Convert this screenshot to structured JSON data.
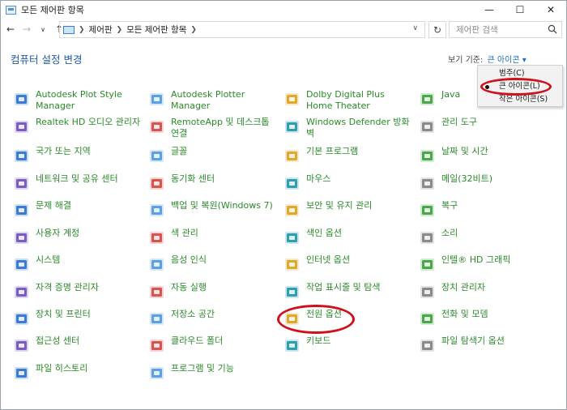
{
  "window": {
    "title": "모든 제어판 항목",
    "controls": {
      "minimize": "—",
      "maximize": "☐",
      "close": "✕"
    }
  },
  "nav": {
    "back": "←",
    "forward": "→",
    "recent": "∨",
    "up": "↑"
  },
  "breadcrumb": [
    "제어판",
    "모든 제어판 항목"
  ],
  "refresh": "↻",
  "search": {
    "placeholder": "제어판 검색"
  },
  "page": {
    "title": "컴퓨터 설정 변경",
    "view_by_label": "보기 기준:",
    "view_by_value": "큰 아이콘 ▾"
  },
  "view_menu": [
    {
      "label": "범주(C)",
      "selected": false
    },
    {
      "label": "큰 아이콘(L)",
      "selected": true
    },
    {
      "label": "작은 아이콘(S)",
      "selected": false
    }
  ],
  "items": [
    [
      "Autodesk Plot Style Manager",
      "Autodesk Plotter Manager",
      "Dolby Digital Plus Home Theater",
      "Java"
    ],
    [
      "Realtek HD 오디오 관리자",
      "RemoteApp 및 데스크톱 연결",
      "Windows Defender 방화벽",
      "관리 도구"
    ],
    [
      "국가 또는 지역",
      "글꼴",
      "기본 프로그램",
      "날짜 및 시간"
    ],
    [
      "네트워크 및 공유 센터",
      "동기화 센터",
      "마우스",
      "메일(32비트)"
    ],
    [
      "문제 해결",
      "백업 및 복원(Windows 7)",
      "보안 및 유지 관리",
      "복구"
    ],
    [
      "사용자 계정",
      "색 관리",
      "색인 옵션",
      "소리"
    ],
    [
      "시스템",
      "음성 인식",
      "인터넷 옵션",
      "인텔® HD 그래픽"
    ],
    [
      "자격 증명 관리자",
      "자동 실행",
      "작업 표시줄 및 탐색",
      "장치 관리자"
    ],
    [
      "장치 및 프린터",
      "저장소 공간",
      "전원 옵션",
      "전화 및 모뎀"
    ],
    [
      "접근성 센터",
      "클라우드 폴더",
      "키보드",
      "파일 탐색기 옵션"
    ],
    [
      "파일 히스토리",
      "프로그램 및 기능",
      "",
      ""
    ]
  ],
  "colors": {
    "link_green": "#2a8a2a",
    "title_blue": "#1f5aa6",
    "highlight_red": "#d0101a"
  }
}
